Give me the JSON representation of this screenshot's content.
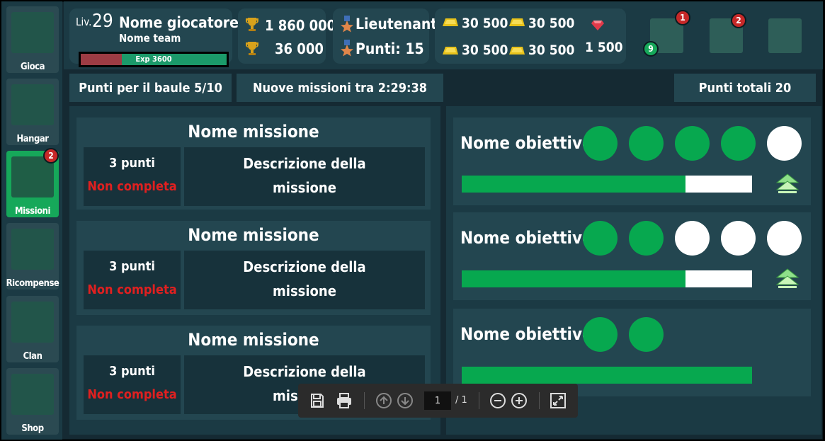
{
  "sidebar": {
    "items": [
      {
        "label": "Gioca",
        "active": false
      },
      {
        "label": "Hangar",
        "active": false
      },
      {
        "label": "Missioni",
        "active": true,
        "badge": "2"
      },
      {
        "label": "Ricompense",
        "active": false
      },
      {
        "label": "Clan",
        "active": false
      },
      {
        "label": "Shop",
        "active": false
      }
    ]
  },
  "player": {
    "level_prefix": "Liv.",
    "level": "29",
    "name": "Nome giocatore",
    "team": "Nome team",
    "exp_text": "Exp 3600",
    "exp_progress": 0.28
  },
  "trophies": {
    "primary": "1 860 000",
    "secondary": "36 000"
  },
  "rank": {
    "title": "Lieutenant",
    "points": "Punti: 15"
  },
  "currency": {
    "gold": [
      "30 500",
      "30 500",
      "30 500",
      "30 500"
    ],
    "gems": "1 500"
  },
  "top_buttons": {
    "badges": [
      "1",
      "2"
    ],
    "green_badge": "9"
  },
  "info": {
    "chest_points": "Punti per il baule 5/10",
    "new_missions": "Nuove missioni tra 2:29:38",
    "total_points": "Punti totali 20"
  },
  "missions": [
    {
      "title": "Nome missione",
      "points": "3 punti",
      "status": "Non completa",
      "description_line1": "Descrizione della",
      "description_line2": "missione"
    },
    {
      "title": "Nome missione",
      "points": "3 punti",
      "status": "Non completa",
      "description_line1": "Descrizione della",
      "description_line2": "missione"
    },
    {
      "title": "Nome missione",
      "points": "3 punti",
      "status": "Non completa",
      "description_line1": "Descrizione della",
      "description_line2": "missione"
    }
  ],
  "objectives": [
    {
      "title": "Nome obiettivo",
      "dots": [
        true,
        true,
        true,
        true,
        false
      ],
      "progress": 0.77,
      "has_upgrade": true
    },
    {
      "title": "Nome obiettivo",
      "dots": [
        true,
        true,
        false,
        false,
        false
      ],
      "progress": 0.77,
      "has_upgrade": true
    },
    {
      "title": "Nome obiettivo",
      "dots": [
        true,
        true
      ],
      "progress": 1.0,
      "has_upgrade": false
    }
  ],
  "pdf_toolbar": {
    "page_current": "1",
    "page_total": "/ 1"
  },
  "colors": {
    "background": "#152a33",
    "panel": "#234650",
    "accent_green": "#07a84f",
    "status_red": "#e02020",
    "badge_red": "#c62828"
  }
}
